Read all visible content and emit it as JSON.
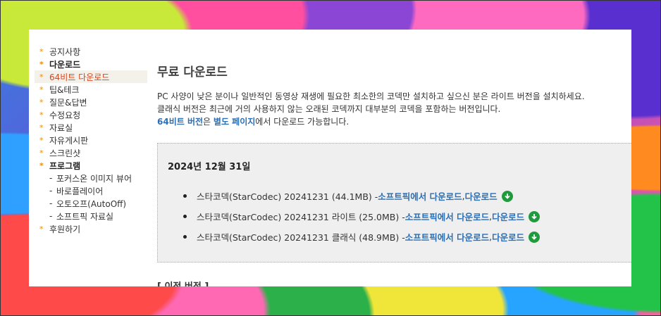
{
  "sidebar": {
    "items": [
      {
        "label": "공지사항"
      },
      {
        "label": "다운로드"
      },
      {
        "label": "64비트 다운로드"
      },
      {
        "label": "팁&테크"
      },
      {
        "label": "질문&답변"
      },
      {
        "label": "수정요청"
      },
      {
        "label": "자료실"
      },
      {
        "label": "자유게시판"
      },
      {
        "label": "스크린샷"
      },
      {
        "label": "프로그램"
      }
    ],
    "sub_items": [
      {
        "label": "포커스온 이미지 뷰어"
      },
      {
        "label": "바로플레이어"
      },
      {
        "label": "오토오프(AutoOff)"
      },
      {
        "label": "소프트픽 자료실"
      }
    ],
    "last_item": {
      "label": "후원하기"
    },
    "star": "*",
    "dash": "-"
  },
  "main": {
    "title": "무료 다운로드",
    "desc_line1": "PC 사양이 낮은 분이나 일반적인 동영상 재생에 필요한 최소한의 코덱만 설치하고 싶으신 분은 라이트 버전을 설치하세요.",
    "desc_line2": "클래식 버전은 최근에 거의 사용하지 않는 오래된 코덱까지 대부분의 코덱을 포함하는 버전입니다.",
    "desc_link1": "64비트 버전",
    "desc_mid1": "은 ",
    "desc_link2": "별도 페이지",
    "desc_end": "에서 다운로드 가능합니다.",
    "date": "2024년 12월 31일",
    "downloads": [
      {
        "text": "스타코덱(StarCodec) 20241231 (44.1MB) - ",
        "link1": "소프트픽에서 다운로드",
        "sep": ", ",
        "link2": "다운로드"
      },
      {
        "text": "스타코덱(StarCodec) 20241231 라이트 (25.0MB) - ",
        "link1": "소프트픽에서 다운로드",
        "sep": ", ",
        "link2": "다운로드"
      },
      {
        "text": "스타코덱(StarCodec) 20241231 클래식 (48.9MB) - ",
        "link1": "소프트픽에서 다운로드",
        "sep": ", ",
        "link2": "다운로드"
      }
    ],
    "previous": "[ 이전 버전 ]"
  },
  "colors": {
    "accent": "#d7461e",
    "link": "#2c6fb5",
    "download_icon": "#1f9a3c"
  }
}
